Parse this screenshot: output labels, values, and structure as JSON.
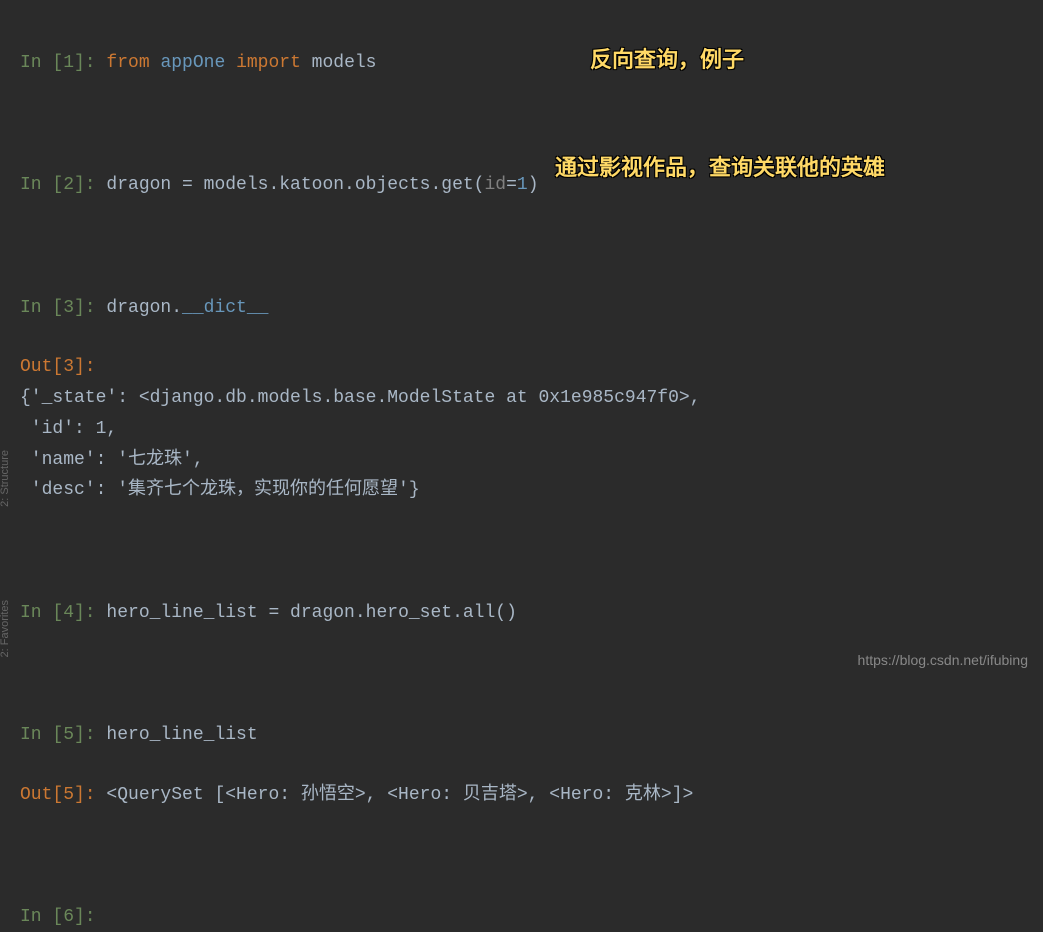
{
  "cells": {
    "in1": {
      "prompt": "In [1]: ",
      "kw_from": "from",
      "module": " appOne ",
      "kw_import": "import",
      "target": " models"
    },
    "in2": {
      "prompt": "In [2]: ",
      "code_a": "dragon = models.katoon.objects.get(",
      "param": "id",
      "eq": "=",
      "val": "1",
      "close": ")"
    },
    "in3": {
      "prompt": "In [3]: ",
      "code_a": "dragon.",
      "dunder": "__dict__"
    },
    "out3": {
      "prompt": "Out[3]:",
      "l1": "{'_state': <django.db.models.base.ModelState at 0x1e985c947f0>,",
      "l2": " 'id': 1,",
      "l3": " 'name': '七龙珠',",
      "l4": " 'desc': '集齐七个龙珠，实现你的任何愿望'}"
    },
    "in4": {
      "prompt": "In [4]: ",
      "code": "hero_line_list = dragon.hero_set.all()"
    },
    "in5": {
      "prompt": "In [5]: ",
      "code": "hero_line_list"
    },
    "out5": {
      "prompt": "Out[5]: ",
      "value": "<QuerySet [<Hero: 孙悟空>, <Hero: 贝吉塔>, <Hero: 克林>]>"
    },
    "in6": {
      "prompt": "In [6]: "
    }
  },
  "annotations": {
    "a1": "反向查询，例子",
    "a2": "通过影视作品，查询关联他的英雄"
  },
  "watermark": "https://blog.csdn.net/ifubing",
  "sidebar": {
    "s1": "2: Structure",
    "s2": "2: Favorites"
  }
}
